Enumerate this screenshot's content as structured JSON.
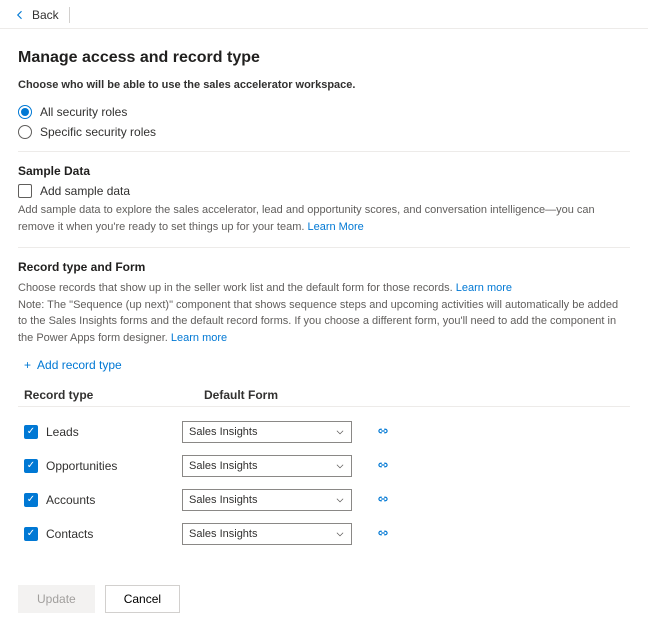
{
  "topbar": {
    "back": "Back"
  },
  "page": {
    "title": "Manage access and record type",
    "subhead": "Choose who will be able to use the sales accelerator workspace."
  },
  "access": {
    "option_all": "All security roles",
    "option_specific": "Specific security roles"
  },
  "sample": {
    "title": "Sample Data",
    "checkbox": "Add sample data",
    "helper": "Add sample data to explore the sales accelerator, lead and opportunity scores, and conversation intelligence—you can remove it when you're ready to set things up for your team. ",
    "learn": "Learn More"
  },
  "recordtype": {
    "title": "Record type and Form",
    "line1": "Choose records that show up in the seller work list and the default form for those records. ",
    "learn1": "Learn more",
    "line2a": "Note: The \"Sequence (up next)\" component that shows sequence steps and upcoming activities will automatically be added to the Sales Insights forms and the default record forms. If you choose a different form, you'll need to add the component in the Power Apps form designer. ",
    "learn2": "Learn more",
    "add": "Add record type",
    "col_record": "Record type",
    "col_form": "Default Form",
    "rows": [
      {
        "label": "Leads",
        "form": "Sales Insights"
      },
      {
        "label": "Opportunities",
        "form": "Sales Insights"
      },
      {
        "label": "Accounts",
        "form": "Sales Insights"
      },
      {
        "label": "Contacts",
        "form": "Sales Insights"
      }
    ]
  },
  "footer": {
    "update": "Update",
    "cancel": "Cancel"
  }
}
